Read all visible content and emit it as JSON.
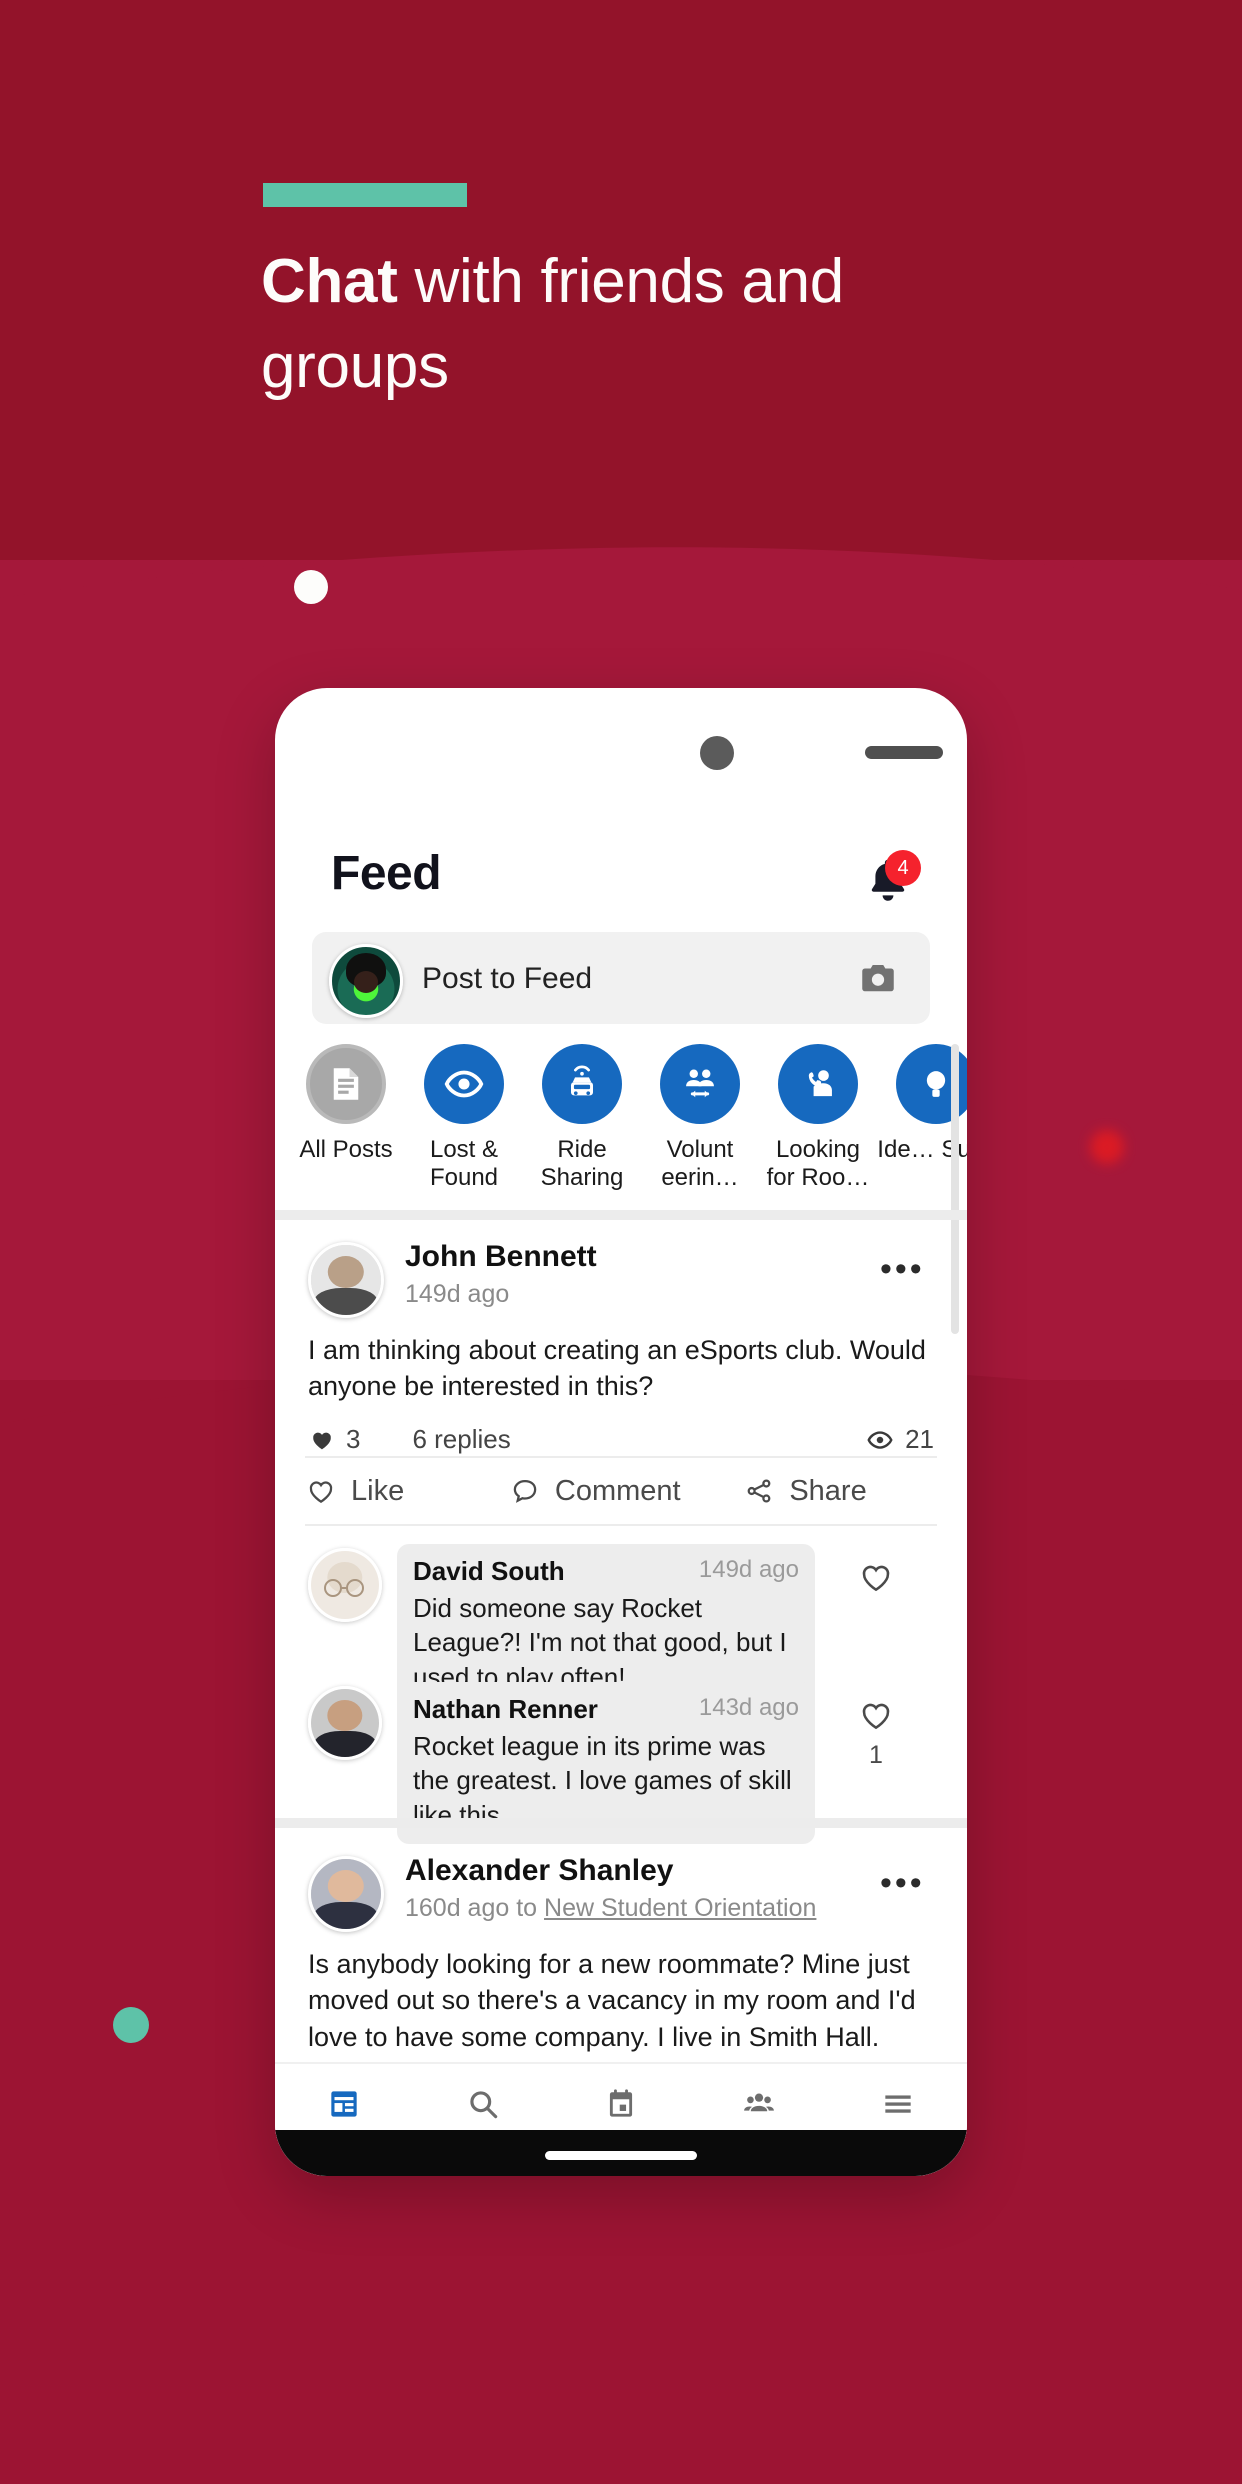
{
  "hero": {
    "headline_bold": "Chat",
    "headline_rest": " with friends and groups",
    "accent_color": "#5ec2a8",
    "background_color": "#93132a"
  },
  "phone": {
    "header": {
      "title": "Feed",
      "notification_icon": "bell-icon",
      "notification_count": "4"
    },
    "composer": {
      "placeholder": "Post to Feed",
      "camera_icon": "camera-icon"
    },
    "categories": [
      {
        "label": "All Posts",
        "icon": "document-icon",
        "active": true
      },
      {
        "label": "Lost & Found",
        "icon": "eye-icon",
        "active": false
      },
      {
        "label": "Ride Sharing",
        "icon": "car-icon",
        "active": false
      },
      {
        "label": "Volunteering",
        "label_display": "Volunt eerin…",
        "icon": "people-exchange-icon",
        "active": false
      },
      {
        "label": "Looking for Roommate",
        "label_display": "Looking for Roo…",
        "icon": "person-support-icon",
        "active": false
      },
      {
        "label": "Idea Submission",
        "label_display": "Ide… Su…",
        "icon": "idea-icon",
        "active": false
      }
    ],
    "posts": [
      {
        "author": "John Bennett",
        "time": "149d ago",
        "group": "",
        "text": "I am thinking about creating an eSports club. Would anyone be interested in this?",
        "likes": "3",
        "replies_label": "6 replies",
        "views": "21",
        "menu_icon": "more-options-icon",
        "actions": [
          {
            "label": "Like",
            "icon": "heart-outline-icon"
          },
          {
            "label": "Comment",
            "icon": "comment-icon"
          },
          {
            "label": "Share",
            "icon": "share-icon"
          }
        ],
        "comments": [
          {
            "author": "David South",
            "time": "149d ago",
            "text": "Did someone say Rocket League?! I'm not that good, but I used to play often!",
            "like_count": ""
          },
          {
            "author": "Nathan Renner",
            "time": "143d ago",
            "text": "Rocket league in its prime was the greatest. I love games of skill like this",
            "like_count": "1"
          }
        ]
      },
      {
        "author": "Alexander Shanley",
        "time": "160d ago to ",
        "group": "New Student Orientation",
        "text": "Is anybody looking for a new roommate? Mine just moved out so there's a vacancy in my room and I'd love to have some company. I live in Smith Hall.",
        "menu_icon": "more-options-icon"
      }
    ],
    "bottom_nav": [
      {
        "label": "Feed",
        "icon": "feed-icon",
        "active": true
      },
      {
        "label": "Discover",
        "icon": "search-icon",
        "active": false
      },
      {
        "label": "Events",
        "icon": "calendar-icon",
        "active": false
      },
      {
        "label": "Groups",
        "icon": "groups-icon",
        "active": false
      },
      {
        "label": "More",
        "icon": "menu-icon",
        "active": false
      }
    ]
  }
}
